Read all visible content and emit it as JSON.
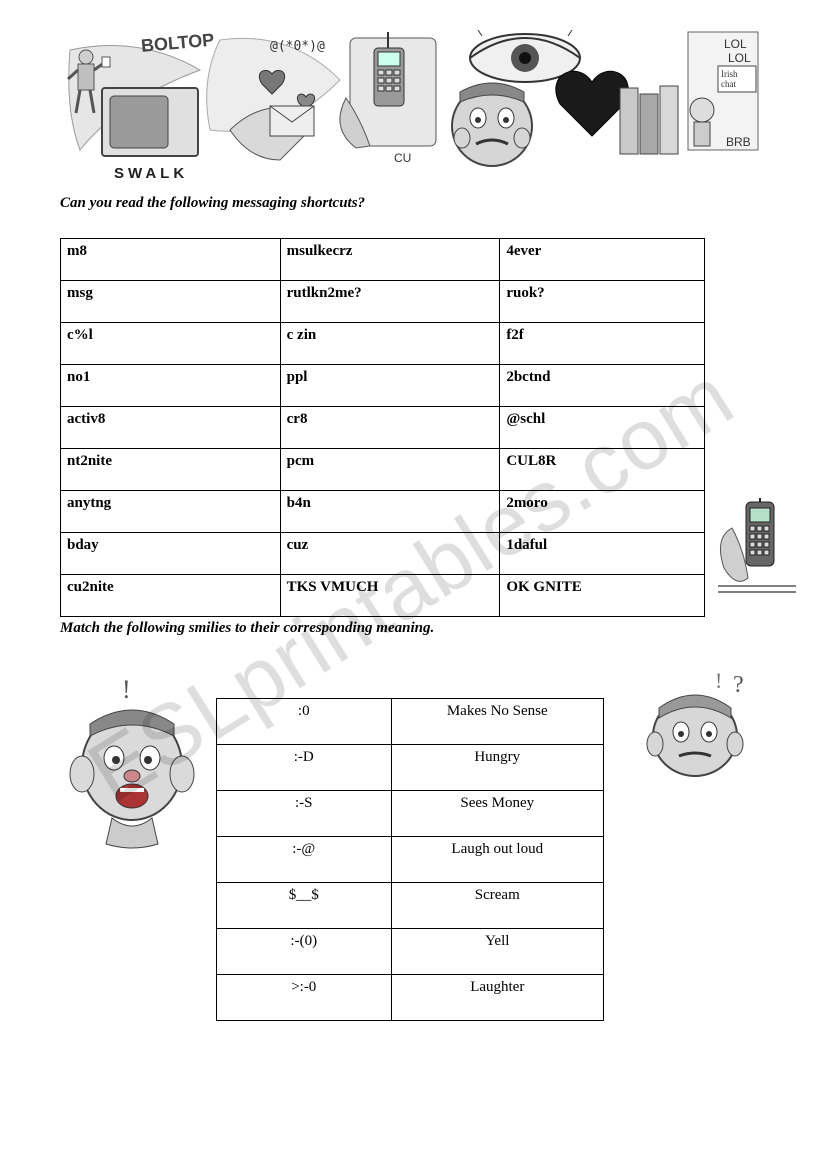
{
  "heading1": "Can you read the following messaging shortcuts?",
  "heading2": "Match the following smilies to their corresponding meaning.",
  "watermark": "ESLprintables.com",
  "table1": {
    "rows": [
      {
        "c1": "m8",
        "c2": "msulkecrz",
        "c3": "4ever"
      },
      {
        "c1": "msg",
        "c2": "rutlkn2me?",
        "c3": "ruok?"
      },
      {
        "c1": "c%l",
        "c2": "c zin",
        "c3": "f2f"
      },
      {
        "c1": "no1",
        "c2": "ppl",
        "c3": "2bctnd"
      },
      {
        "c1": "activ8",
        "c2": "cr8",
        "c3": "@schl"
      },
      {
        "c1": "nt2nite",
        "c2": "pcm",
        "c3": "CUL8R"
      },
      {
        "c1": "anytng",
        "c2": "b4n",
        "c3": "2moro"
      },
      {
        "c1": "bday",
        "c2": "cuz",
        "c3": "1daful"
      },
      {
        "c1": "cu2nite",
        "c2": "TKS VMUCH",
        "c3": "OK GNITE"
      }
    ]
  },
  "table2": {
    "rows": [
      {
        "smiley": ":0",
        "meaning": "Makes No Sense"
      },
      {
        "smiley": ":-D",
        "meaning": "Hungry"
      },
      {
        "smiley": ":-S",
        "meaning": "Sees Money"
      },
      {
        "smiley": ":-@",
        "meaning": "Laugh out loud"
      },
      {
        "smiley": "$__$",
        "meaning": "Scream"
      },
      {
        "smiley": ":-(0)",
        "meaning": "Yell"
      },
      {
        "smiley": ">:-0",
        "meaning": "Laughter"
      }
    ]
  },
  "header_art": {
    "text_boltop": "BOLTOP",
    "text_swalk": "SWALK",
    "text_cu": "CU",
    "text_brb": "BRB",
    "text_lol1": "LOL",
    "text_lol2": "LOL",
    "text_irish": "Irish chat",
    "text_ascii": "@(*0*)@"
  }
}
